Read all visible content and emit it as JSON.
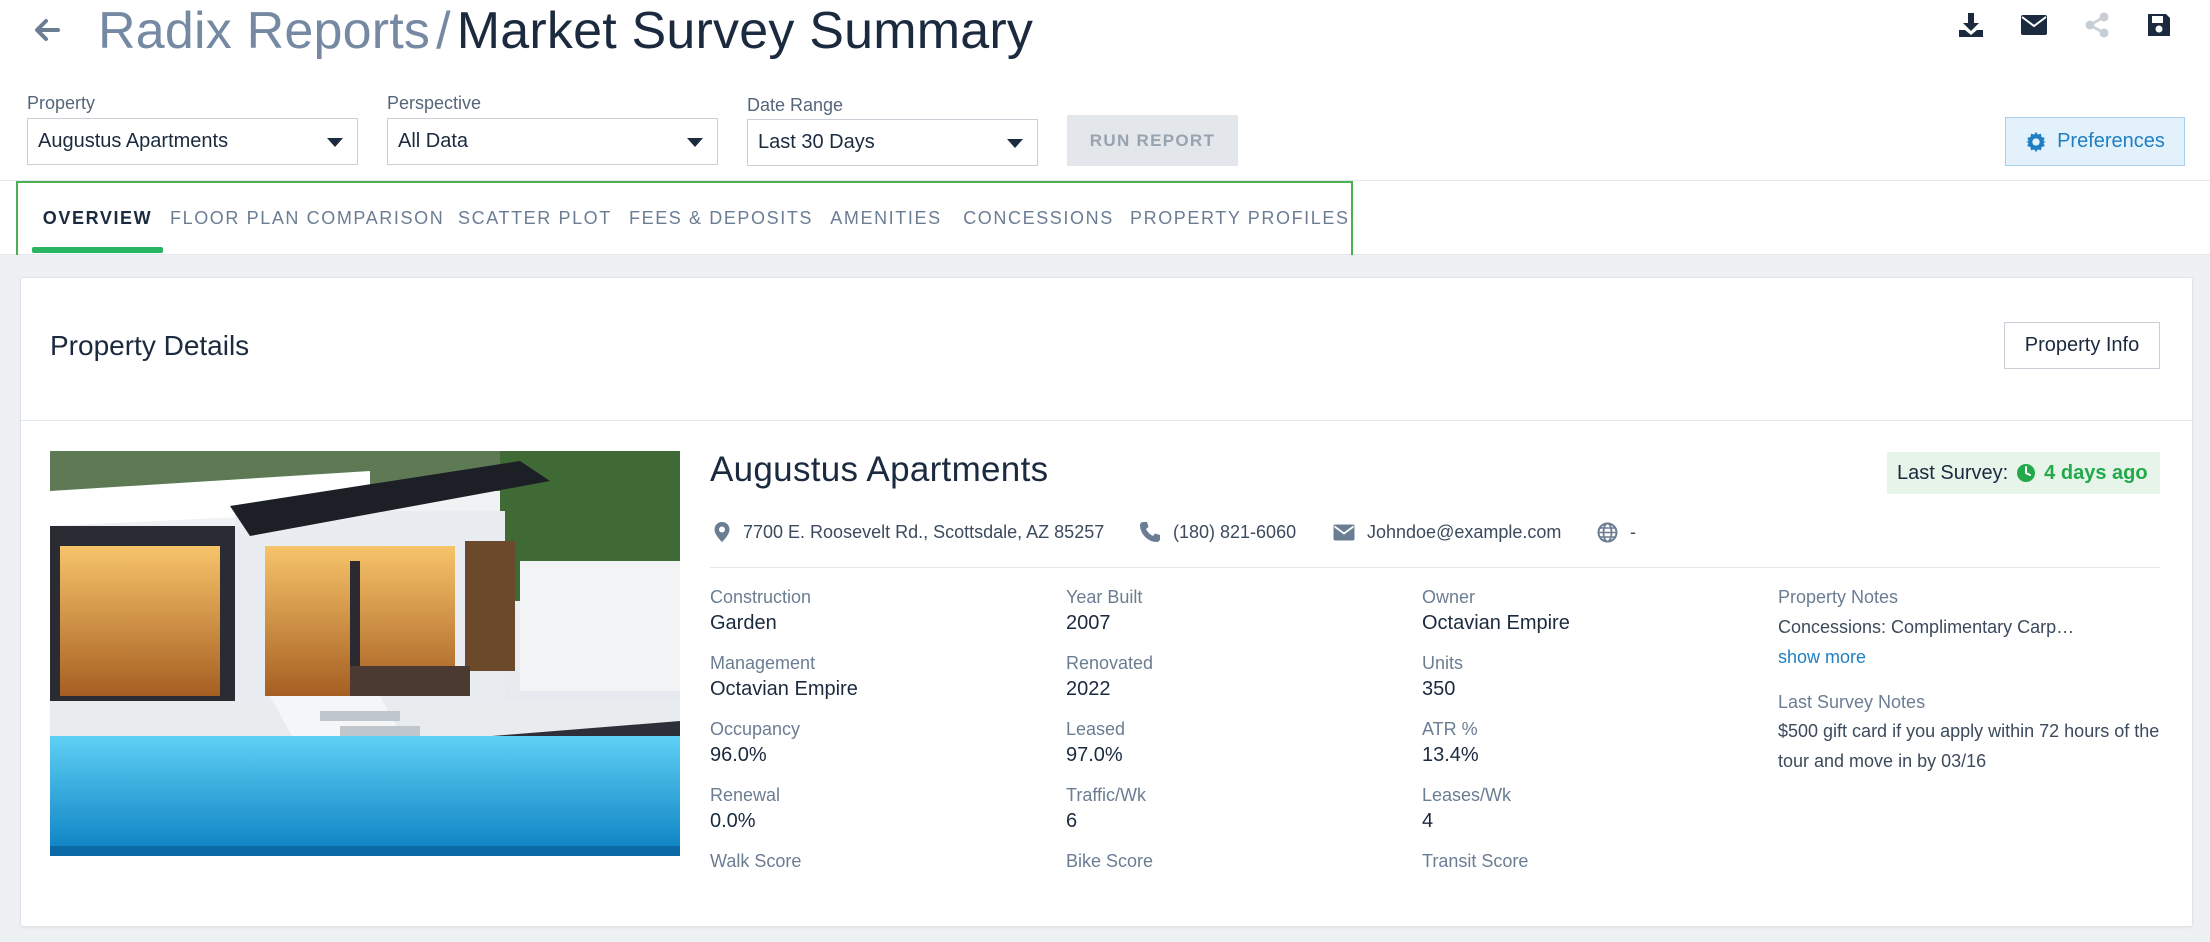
{
  "header": {
    "breadcrumb": "Radix Reports",
    "separator": "/",
    "title": "Market Survey Summary",
    "icons": [
      "back-arrow-icon",
      "download-icon",
      "envelope-icon",
      "share-icon",
      "save-icon"
    ]
  },
  "filters": {
    "property": {
      "label": "Property",
      "value": "Augustus Apartments"
    },
    "perspective": {
      "label": "Perspective",
      "value": "All Data"
    },
    "date_range": {
      "label": "Date Range",
      "value": "Last 30 Days"
    },
    "run_label": "RUN REPORT",
    "preferences_label": "Preferences"
  },
  "tabs": [
    {
      "label": "OVERVIEW",
      "active": true
    },
    {
      "label": "FLOOR PLAN COMPARISON",
      "active": false
    },
    {
      "label": "SCATTER PLOT",
      "active": false
    },
    {
      "label": "FEES & DEPOSITS",
      "active": false
    },
    {
      "label": "AMENITIES",
      "active": false
    },
    {
      "label": "CONCESSIONS",
      "active": false
    },
    {
      "label": "PROPERTY PROFILES",
      "active": false
    }
  ],
  "card": {
    "title": "Property Details",
    "info_button": "Property Info"
  },
  "property": {
    "name": "Augustus Apartments",
    "last_survey_label": "Last Survey:",
    "last_survey_value": "4 days ago",
    "address": "7700 E. Roosevelt Rd., Scottsdale, AZ 85257",
    "phone": "(180) 821-6060",
    "email": "Johndoe@example.com",
    "website": "-"
  },
  "stats": {
    "construction": {
      "label": "Construction",
      "value": "Garden"
    },
    "year_built": {
      "label": "Year Built",
      "value": "2007"
    },
    "owner": {
      "label": "Owner",
      "value": "Octavian Empire"
    },
    "management": {
      "label": "Management",
      "value": "Octavian Empire"
    },
    "renovated": {
      "label": "Renovated",
      "value": "2022"
    },
    "units": {
      "label": "Units",
      "value": "350"
    },
    "occupancy": {
      "label": "Occupancy",
      "value": "96.0%"
    },
    "leased": {
      "label": "Leased",
      "value": "97.0%"
    },
    "atr": {
      "label": "ATR %",
      "value": "13.4%"
    },
    "renewal": {
      "label": "Renewal",
      "value": "0.0%"
    },
    "traffic": {
      "label": "Traffic/Wk",
      "value": "6"
    },
    "leases": {
      "label": "Leases/Wk",
      "value": "4"
    },
    "walk_score": {
      "label": "Walk Score"
    },
    "bike_score": {
      "label": "Bike Score"
    },
    "transit_score": {
      "label": "Transit Score"
    }
  },
  "notes": {
    "property_notes_label": "Property Notes",
    "property_notes_text": "Concessions: Complimentary Carp…",
    "show_more": "show more",
    "last_survey_notes_label": "Last Survey Notes",
    "last_survey_notes_text": "$500 gift card if you apply within 72 hours of the tour and move in by 03/16"
  },
  "colors": {
    "accent_green": "#28b463",
    "accent_blue": "#1f7fc4",
    "text_dark": "#1b2a3e",
    "text_muted": "#6b7d93"
  }
}
